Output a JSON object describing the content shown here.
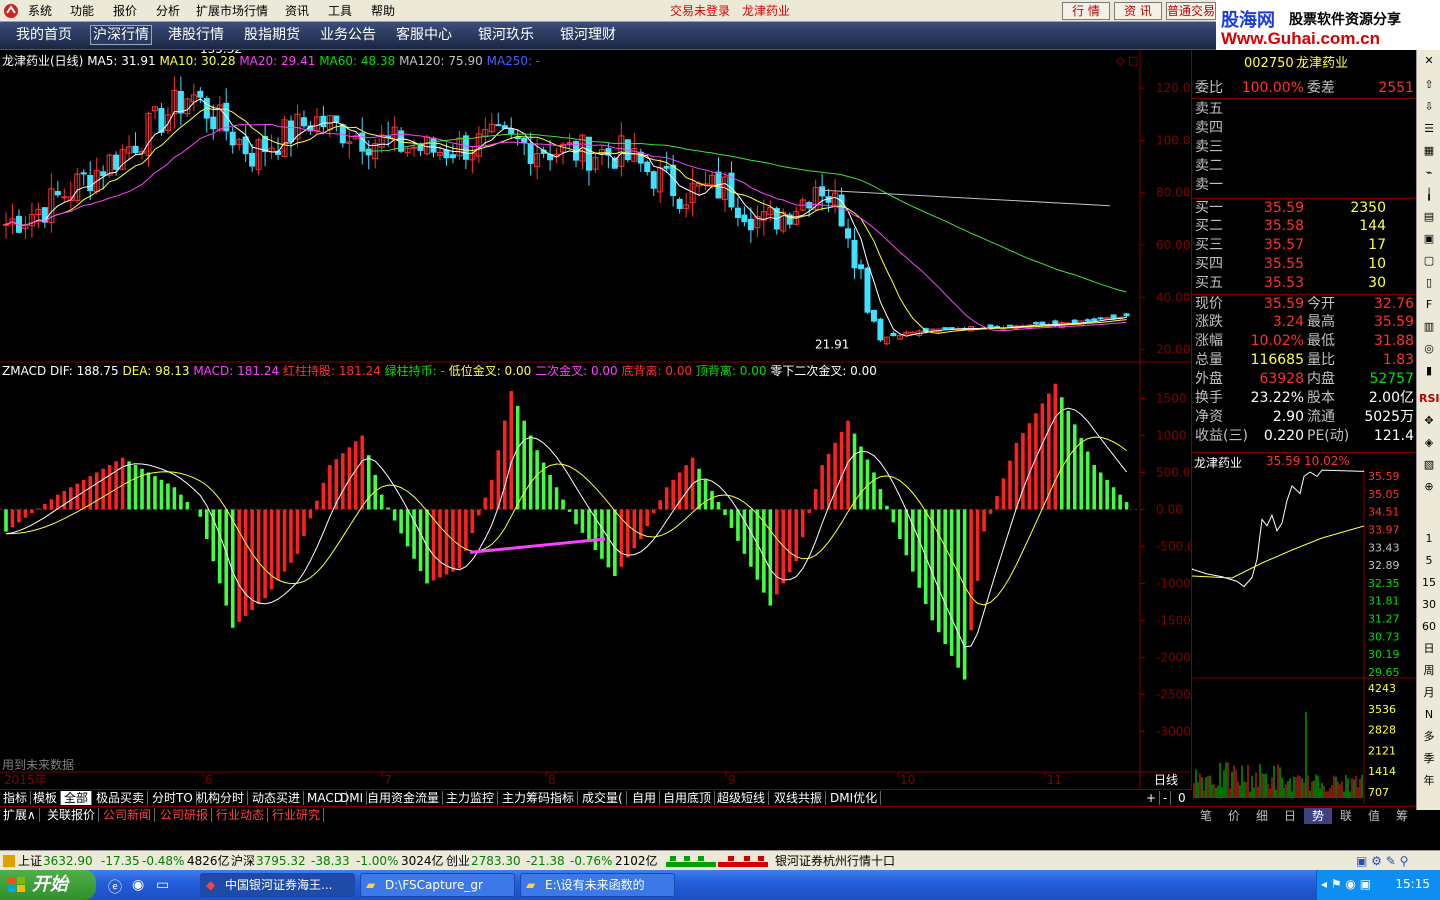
{
  "menubar": {
    "items": [
      "系统",
      "功能",
      "报价",
      "分析",
      "扩展市场行情",
      "资讯",
      "工具",
      "帮助"
    ],
    "trade_status": "交易未登录",
    "stock_name": "龙津药业",
    "buttons": [
      "行 情",
      "资 讯",
      "普通交易"
    ]
  },
  "brand": {
    "cn": "股海网",
    "tagline": "股票软件资源分享",
    "url": "Www.Guhai.com.cn"
  },
  "navbar": {
    "items": [
      "我的首页",
      "沪深行情",
      "港股行情",
      "股指期货",
      "业务公告",
      "客服中心",
      "银河玖乐",
      "银河理财"
    ],
    "active": "沪深行情"
  },
  "price_chart": {
    "legend": {
      "name": "龙津药业(日线)",
      "ma5": "MA5: 31.91",
      "ma10": "MA10: 30.28",
      "ma20": "MA20: 29.41",
      "ma60": "MA60: 48.38",
      "ma120": "MA120: 75.90",
      "ma250": "MA250: -"
    },
    "high_label": "135.32",
    "low_label": "21.91",
    "y_ticks": [
      "120.0",
      "100.0",
      "80.00",
      "60.00",
      "40.00",
      "20.00"
    ],
    "y_values": [
      120,
      100,
      80,
      60,
      40,
      20
    ]
  },
  "macd_chart": {
    "legend": {
      "name": "ZMACD",
      "dif": "DIF: 188.75",
      "dea": "DEA: 98.13",
      "macd": "MACD: 181.24",
      "red_hold": "红柱持股: 181.24",
      "green_hold": "绿柱持币: -",
      "low_cross": "低位金叉: 0.00",
      "second_cross": "二次金叉: 0.00",
      "bottom_div": "底背离: 0.00",
      "top_div": "顶背离: 0.00",
      "zero_cross": "零下二次金叉: 0.00"
    },
    "y_ticks": [
      "1500",
      "1000",
      "500.0",
      "0.00",
      "-500.0",
      "-1000",
      "-1500",
      "-2000",
      "-2500",
      "-3000"
    ],
    "y_values": [
      1500,
      1000,
      500,
      0,
      -500,
      -1000,
      -1500,
      -2000,
      -2500,
      -3000
    ],
    "future_note": "用到未来数据"
  },
  "x_axis": {
    "year": "2015年",
    "months": [
      "6",
      "7",
      "8",
      "9",
      "10",
      "11"
    ],
    "period": "日线"
  },
  "tabs_row1": [
    "指标",
    "模板",
    "全部",
    "极品买卖",
    "分时TO",
    "机构分时",
    "动态买进",
    "MACD",
    "DMI",
    "自用资金流量",
    "主力监控",
    "主力筹码指标",
    "成交量(",
    "自用",
    "自用底顶",
    "超级短线",
    "双线共振",
    "DMI优化"
  ],
  "tabs_row1_active": "全部",
  "tabs_row1_controls": [
    "+",
    "-",
    "0"
  ],
  "tabs_row2": [
    "扩展∧",
    "关联报价",
    "公司新闻",
    "公司研报",
    "行业动态",
    "行业研究"
  ],
  "quote_panel": {
    "code": "002750",
    "name": "龙津药业",
    "wei_bi_label": "委比",
    "wei_bi": "100.00%",
    "wei_cha_label": "委差",
    "wei_cha": "2551",
    "sell": [
      {
        "label": "卖五",
        "price": "",
        "vol": ""
      },
      {
        "label": "卖四",
        "price": "",
        "vol": ""
      },
      {
        "label": "卖三",
        "price": "",
        "vol": ""
      },
      {
        "label": "卖二",
        "price": "",
        "vol": ""
      },
      {
        "label": "卖一",
        "price": "",
        "vol": ""
      }
    ],
    "buy": [
      {
        "label": "买一",
        "price": "35.59",
        "vol": "2350"
      },
      {
        "label": "买二",
        "price": "35.58",
        "vol": "144"
      },
      {
        "label": "买三",
        "price": "35.57",
        "vol": "17"
      },
      {
        "label": "买四",
        "price": "35.55",
        "vol": "10"
      },
      {
        "label": "买五",
        "price": "35.53",
        "vol": "30"
      }
    ],
    "stats": [
      {
        "l1": "现价",
        "v1": "35.59",
        "c1": "red",
        "l2": "今开",
        "v2": "32.76",
        "c2": "red"
      },
      {
        "l1": "涨跌",
        "v1": "3.24",
        "c1": "red",
        "l2": "最高",
        "v2": "35.59",
        "c2": "red"
      },
      {
        "l1": "涨幅",
        "v1": "10.02%",
        "c1": "red",
        "l2": "最低",
        "v2": "31.88",
        "c2": "red"
      },
      {
        "l1": "总量",
        "v1": "116685",
        "c1": "yel",
        "l2": "量比",
        "v2": "1.83",
        "c2": "red"
      },
      {
        "l1": "外盘",
        "v1": "63928",
        "c1": "red",
        "l2": "内盘",
        "v2": "52757",
        "c2": "grn"
      },
      {
        "l1": "换手",
        "v1": "23.22%",
        "c1": "wht",
        "l2": "股本",
        "v2": "2.00亿",
        "c2": "wht"
      },
      {
        "l1": "净资",
        "v1": "2.90",
        "c1": "wht",
        "l2": "流通",
        "v2": "5025万",
        "c2": "wht"
      },
      {
        "l1": "收益(三)",
        "v1": "0.220",
        "c1": "wht",
        "l2": "PE(动)",
        "v2": "121.4",
        "c2": "wht"
      }
    ],
    "mini": {
      "name": "龙津药业",
      "price": "35.59",
      "pct": "10.02%",
      "price_ticks": [
        "35.59",
        "35.05",
        "34.51",
        "33.97",
        "33.43",
        "32.89",
        "32.35",
        "31.81",
        "31.27",
        "30.73",
        "30.19",
        "29.65"
      ],
      "vol_ticks": [
        "4243",
        "3536",
        "2828",
        "2121",
        "1414",
        "707"
      ]
    },
    "tabs": [
      "笔",
      "价",
      "细",
      "日",
      "势",
      "联",
      "值",
      "筹"
    ],
    "active_tab": "势"
  },
  "right_toolbar": [
    "1",
    "5",
    "15",
    "30",
    "60",
    "日",
    "周",
    "月",
    "N",
    "多",
    "季",
    "年"
  ],
  "statusbar": {
    "sh": {
      "label": "上证",
      "price": "3632.90",
      "chg": "-17.35",
      "pct": "-0.48%",
      "amt": "4826亿"
    },
    "hs": {
      "label": "沪深",
      "price": "3795.32",
      "chg": "-38.33",
      "pct": "-1.00%",
      "amt": "3024亿"
    },
    "cy": {
      "label": "创业",
      "price": "2783.30",
      "chg": "-21.38",
      "pct": "-0.76%",
      "amt": "2102亿"
    },
    "server": "银河证券杭州行情十口"
  },
  "taskbar": {
    "start": "开始",
    "tasks": [
      "中国银河证券海王...",
      "D:\\FSCapture_gr",
      "E:\\设有未来函数的"
    ],
    "clock": "15:15"
  },
  "colors": {
    "up": "#ff3030",
    "down": "#40ff40",
    "ma5": "#ffffff",
    "ma10": "#ffff40",
    "ma20": "#ff40ff",
    "ma60": "#40e040",
    "ma120": "#c0c0c0",
    "bg": "#000000",
    "grid": "#800000"
  }
}
